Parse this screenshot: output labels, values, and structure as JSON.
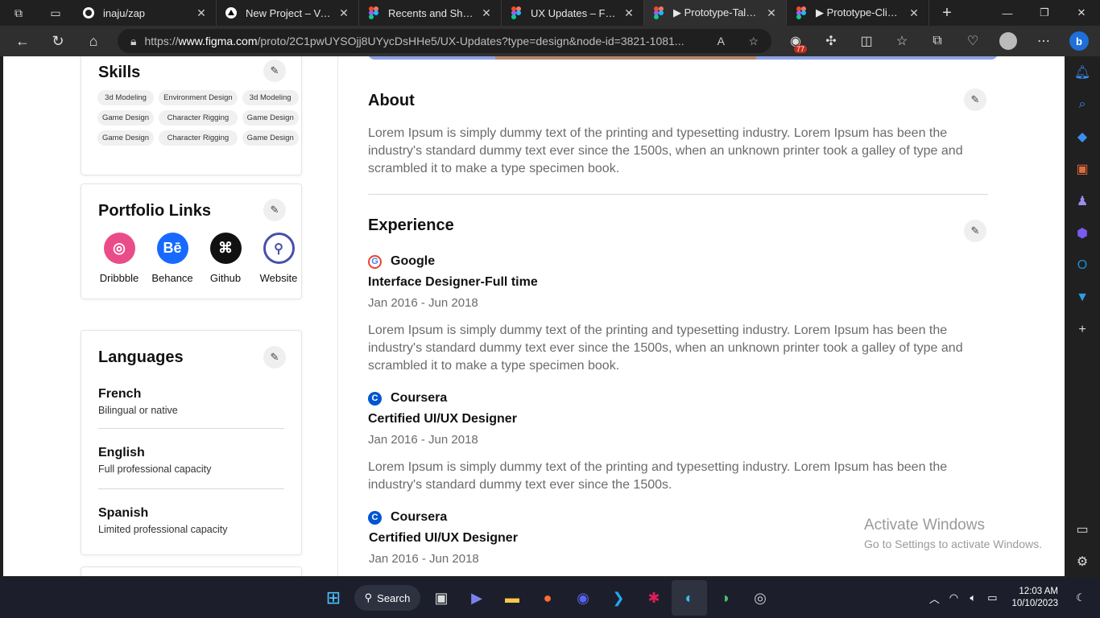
{
  "browser": {
    "tabs": [
      {
        "title": "inaju/zap",
        "icon": "github-icon"
      },
      {
        "title": "New Project – Vercel",
        "icon": "vercel-icon"
      },
      {
        "title": "Recents and Sharing",
        "icon": "figma-icon"
      },
      {
        "title": "UX Updates – Figma",
        "icon": "figma-icon"
      },
      {
        "title": "▶ Prototype-Talent (",
        "icon": "figma-icon",
        "active": true
      },
      {
        "title": "▶ Prototype-Client (",
        "icon": "figma-icon"
      }
    ],
    "url_prefix": "https://",
    "url_host": "www.figma.com",
    "url_path": "/proto/2C1pwUYSOjj8UYycDsHHe5/UX-Updates?type=design&node-id=3821-1081...",
    "extension_badge": "77"
  },
  "skills": {
    "title": "Skills",
    "chips": [
      "3d Modeling",
      "Environment Design",
      "3d Modeling",
      "Game Design",
      "Character Rigging",
      "Game Design",
      "Game Design",
      "Character Rigging",
      "Game Design"
    ]
  },
  "portfolio": {
    "title": "Portfolio Links",
    "links": [
      {
        "label": "Dribbble",
        "color": "#ea4c89"
      },
      {
        "label": "Behance",
        "color": "#1769ff"
      },
      {
        "label": "Github",
        "color": "#111111"
      },
      {
        "label": "Website",
        "color": "#4a4fa8"
      }
    ]
  },
  "languages": {
    "title": "Languages",
    "items": [
      {
        "name": "French",
        "level": "Bilingual or native"
      },
      {
        "name": "English",
        "level": "Full professional capacity"
      },
      {
        "name": "Spanish",
        "level": "Limited professional  capacity"
      }
    ]
  },
  "about": {
    "title": "About",
    "text": "Lorem Ipsum is simply dummy text of the printing and typesetting industry. Lorem Ipsum has been the industry's standard dummy text ever since the 1500s, when an unknown printer took a galley of type and scrambled it to make a type specimen book."
  },
  "experience": {
    "title": "Experience",
    "items": [
      {
        "company": "Google",
        "role": "Interface Designer-Full time",
        "dates": "Jan 2016 - Jun 2018",
        "text": "Lorem Ipsum is simply dummy text of the printing and typesetting industry. Lorem Ipsum has been the industry's standard dummy text ever since the 1500s, when an unknown printer took a galley of type and scrambled it to make a type specimen book."
      },
      {
        "company": "Coursera",
        "role": "Certified UI/UX Designer",
        "dates": "Jan 2016 - Jun 2018",
        "text": "Lorem Ipsum is simply dummy text of the printing and typesetting industry. Lorem Ipsum has been the industry's standard dummy text ever since the 1500s."
      },
      {
        "company": "Coursera",
        "role": "Certified UI/UX Designer",
        "dates": "Jan 2016 - Jun 2018"
      }
    ]
  },
  "watermark": {
    "line1": "Activate Windows",
    "line2": "Go to Settings to activate Windows."
  },
  "taskbar": {
    "search_label": "Search",
    "time": "12:03 AM",
    "date": "10/10/2023"
  },
  "colors": {
    "accent_google": "#4285f4",
    "accent_coursera": "#0056d2",
    "banner": "#8da3e6"
  }
}
